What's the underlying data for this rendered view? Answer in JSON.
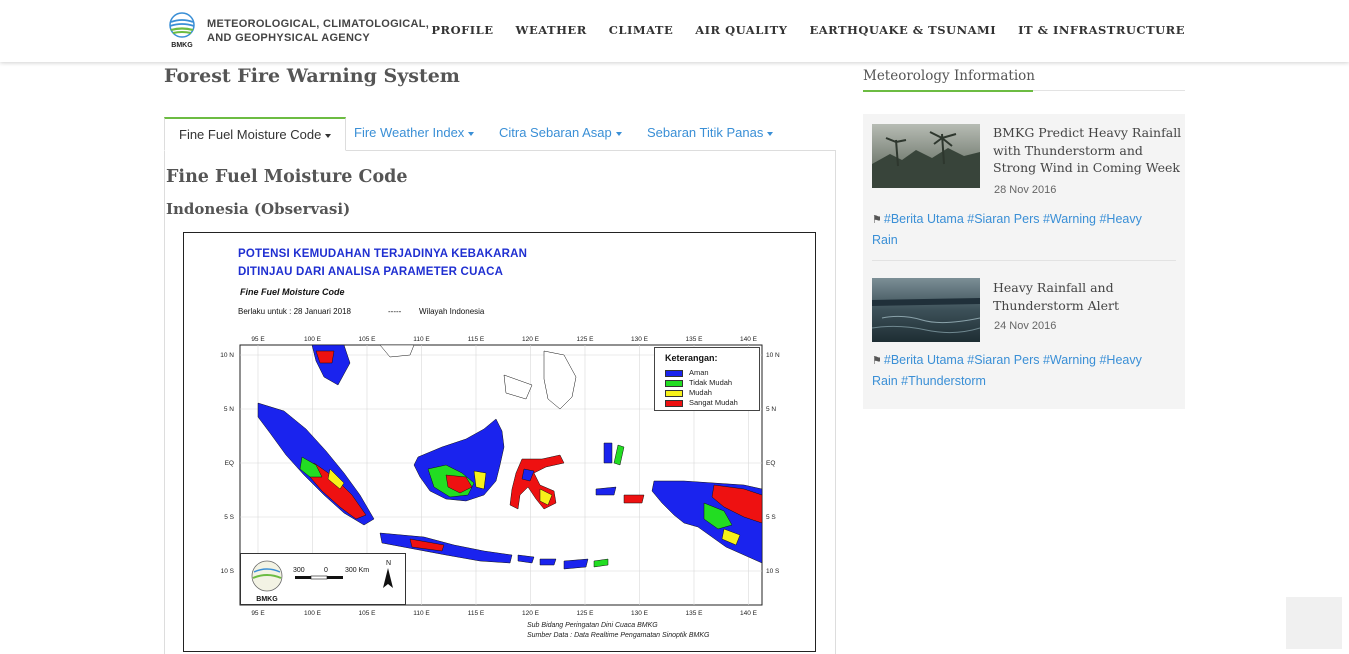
{
  "header": {
    "agency_line1": "METEOROLOGICAL, CLIMATOLOGICAL,",
    "agency_line2": "AND GEOPHYSICAL AGENCY",
    "logo_text": "BMKG",
    "nav": [
      "PROFILE",
      "WEATHER",
      "CLIMATE",
      "AIR QUALITY",
      "EARTHQUAKE & TSUNAMI",
      "IT & INFRASTRUCTURE"
    ]
  },
  "main": {
    "page_title": "Forest Fire Warning System",
    "tabs": [
      "Fine Fuel Moisture Code",
      "Fire Weather Index",
      "Citra Sebaran Asap",
      "Sebaran Titik Panas"
    ],
    "active_tab": 0,
    "section_title": "Fine Fuel Moisture Code",
    "section_subtitle": "Indonesia (Observasi)"
  },
  "map": {
    "title_line1": "POTENSI KEMUDAHAN TERJADINYA KEBAKARAN",
    "title_line2": "DITINJAU DARI ANALISA PARAMETER CUACA",
    "title_line3": "Fine Fuel Moisture Code",
    "valid_label": "Berlaku untuk  :  28 Januari 2018",
    "separator": "-----",
    "region": "Wilayah Indonesia",
    "lon_ticks": [
      "95 E",
      "100 E",
      "105 E",
      "110 E",
      "115 E",
      "120 E",
      "125 E",
      "130 E",
      "135 E",
      "140 E"
    ],
    "lat_ticks": [
      "10 N",
      "5 N",
      "EQ",
      "5 S",
      "10 S"
    ],
    "legend_title": "Keterangan:",
    "legend": [
      {
        "label": "Aman",
        "color": "#1a23ee"
      },
      {
        "label": "Tidak Mudah",
        "color": "#22dd22"
      },
      {
        "label": "Mudah",
        "color": "#f7f11a"
      },
      {
        "label": "Sangat Mudah",
        "color": "#ee1111"
      }
    ],
    "scale_labels": [
      "300",
      "0",
      "300 Km"
    ],
    "north_label": "N",
    "logo_text": "BMKG",
    "credit_line1": "Sub Bidang Peringatan Dini Cuaca BMKG",
    "credit_line2": "Sumber Data : Data Realtime Pengamatan Sinoptik BMKG"
  },
  "sidebar": {
    "title": "Meteorology Information",
    "news": [
      {
        "title": "BMKG Predict Heavy Rainfall with Thunderstorm and Strong Wind in Coming Week",
        "title_lines": [
          "BMKG Predict Heavy Rainfall",
          "with Thunderstorm and",
          "Strong Wind in Coming Week"
        ],
        "date": "28 Nov 2016",
        "tags_line1": "#Berita Utama #Siaran Pers #Warning #Heavy",
        "tags_line2": "Rain"
      },
      {
        "title": "Heavy Rainfall and Thunderstorm Alert",
        "title_lines": [
          "Heavy Rainfall and",
          "Thunderstorm Alert"
        ],
        "date": "24 Nov 2016",
        "tags_line1": "#Berita Utama #Siaran Pers #Warning #Heavy",
        "tags_line2": "Rain #Thunderstorm"
      }
    ]
  },
  "colors": {
    "accent_green": "#6cbc42",
    "link_blue": "#3a8fd6"
  }
}
